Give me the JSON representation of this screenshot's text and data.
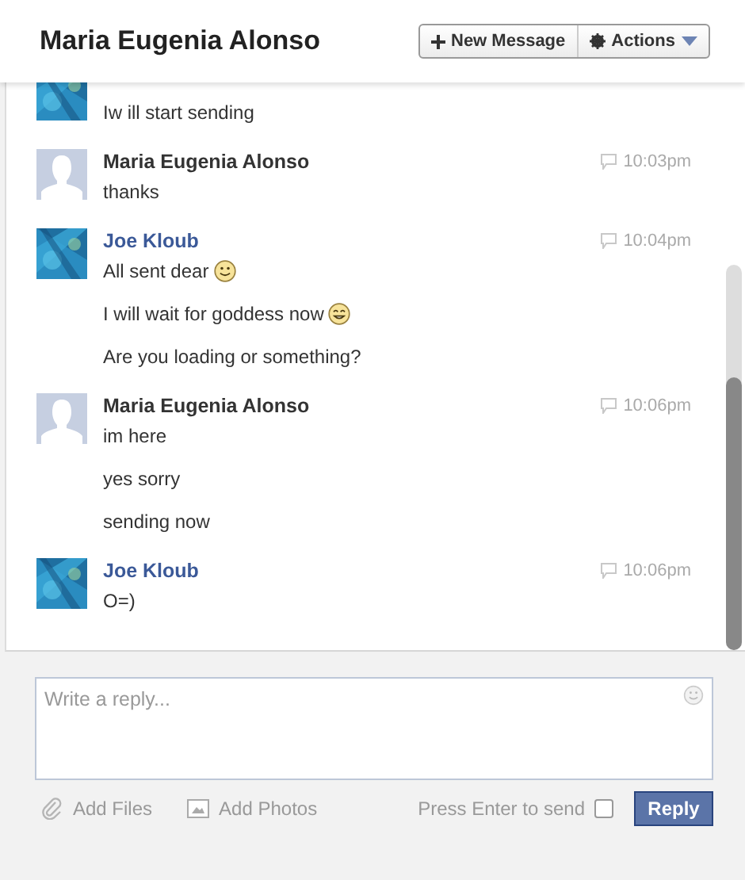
{
  "header": {
    "title": "Maria Eugenia Alonso",
    "buttons": [
      {
        "kind": "new",
        "label": "New Message"
      },
      {
        "kind": "actions",
        "label": "Actions"
      }
    ]
  },
  "groups": [
    {
      "kind": "friend",
      "messages": [
        {
          "text": "Iw ill start sending"
        }
      ]
    },
    {
      "kind": "self",
      "name": "Maria Eugenia Alonso",
      "time": "10:03pm",
      "messages": [
        {
          "text": "thanks"
        }
      ]
    },
    {
      "kind": "friend",
      "name": "Joe Kloub",
      "time": "10:04pm",
      "messages": [
        {
          "kind": "smile",
          "text": "All sent dear"
        },
        {
          "kind": "grin",
          "text": "I will wait for goddess now"
        },
        {
          "kind": "plain",
          "text": "Are you loading or something?"
        }
      ]
    },
    {
      "kind": "self",
      "name": "Maria Eugenia Alonso",
      "time": "10:06pm",
      "messages": [
        {
          "text": "im here"
        },
        {
          "text": "yes sorry"
        },
        {
          "text": "sending now"
        }
      ]
    },
    {
      "kind": "friend",
      "name": "Joe Kloub",
      "time": "10:06pm",
      "messages": [
        {
          "text": "O=)"
        }
      ]
    }
  ],
  "composer": {
    "placeholder": "Write a reply...",
    "attachments": [
      {
        "kind": "files",
        "label": "Add Files"
      },
      {
        "kind": "photos",
        "label": "Add Photos"
      }
    ],
    "enter_to_send": {
      "label": "Press Enter to send",
      "checked": false
    },
    "send_button": "Reply"
  }
}
